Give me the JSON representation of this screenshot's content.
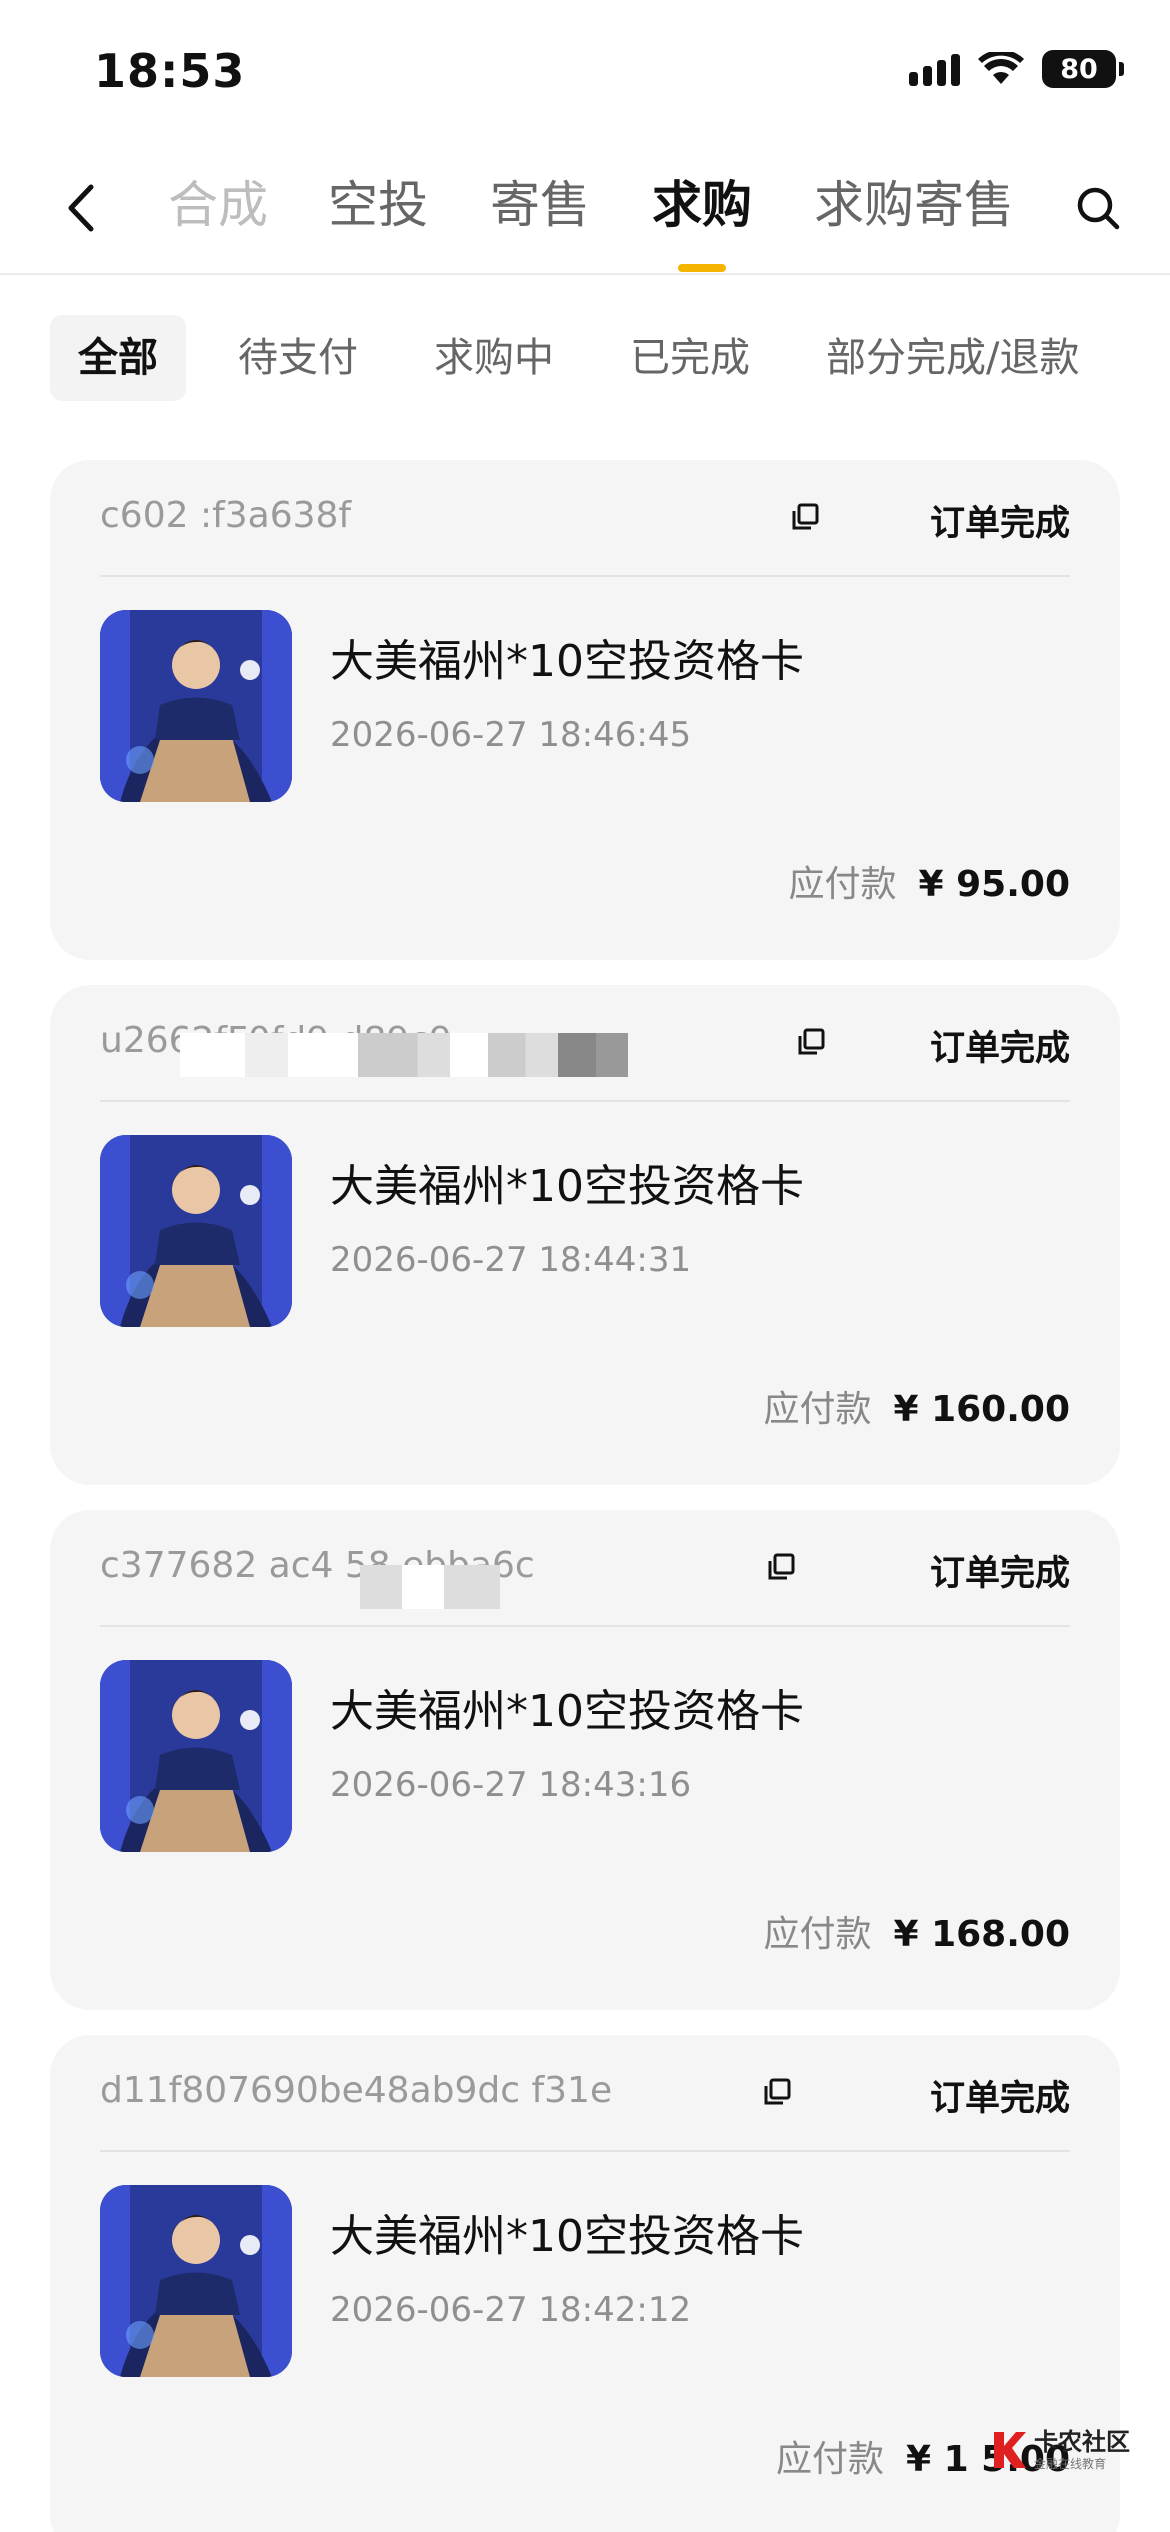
{
  "status_bar": {
    "time": "18:53",
    "battery": "80"
  },
  "nav": {
    "tabs": [
      {
        "label": "合成",
        "state": "faded"
      },
      {
        "label": "空投",
        "state": "normal"
      },
      {
        "label": "寄售",
        "state": "normal"
      },
      {
        "label": "求购",
        "state": "active"
      },
      {
        "label": "求购寄售",
        "state": "normal"
      }
    ]
  },
  "filters": [
    {
      "label": "全部",
      "active": true
    },
    {
      "label": "待支付",
      "active": false
    },
    {
      "label": "求购中",
      "active": false
    },
    {
      "label": "已完成",
      "active": false
    },
    {
      "label": "部分完成/退款",
      "active": false
    }
  ],
  "orders": [
    {
      "id": "c602                        :f3a638f",
      "status": "订单完成",
      "title": "大美福州*10空投资格卡",
      "time": "2026-06-27 18:46:45",
      "amount_label": "应付款",
      "amount": "¥ 95.00"
    },
    {
      "id": "u2662fF0fd9                          d89c9",
      "status": "订单完成",
      "title": "大美福州*10空投资格卡",
      "time": "2026-06-27 18:44:31",
      "amount_label": "应付款",
      "amount": "¥ 160.00"
    },
    {
      "id": "c377682 ac4  58     ebba6c",
      "status": "订单完成",
      "title": "大美福州*10空投资格卡",
      "time": "2026-06-27 18:43:16",
      "amount_label": "应付款",
      "amount": "¥ 168.00"
    },
    {
      "id": "d11f807690be48ab9dc       f31e",
      "status": "订单完成",
      "title": "大美福州*10空投资格卡",
      "time": "2026-06-27 18:42:12",
      "amount_label": "应付款",
      "amount": "¥ 1 5.00"
    }
  ],
  "watermark": {
    "main": "卡农社区",
    "sub": "金融在线教育"
  },
  "colors": {
    "accent": "#f5b400",
    "card_bg": "#f5f5f5",
    "muted": "#8f8f8f"
  }
}
